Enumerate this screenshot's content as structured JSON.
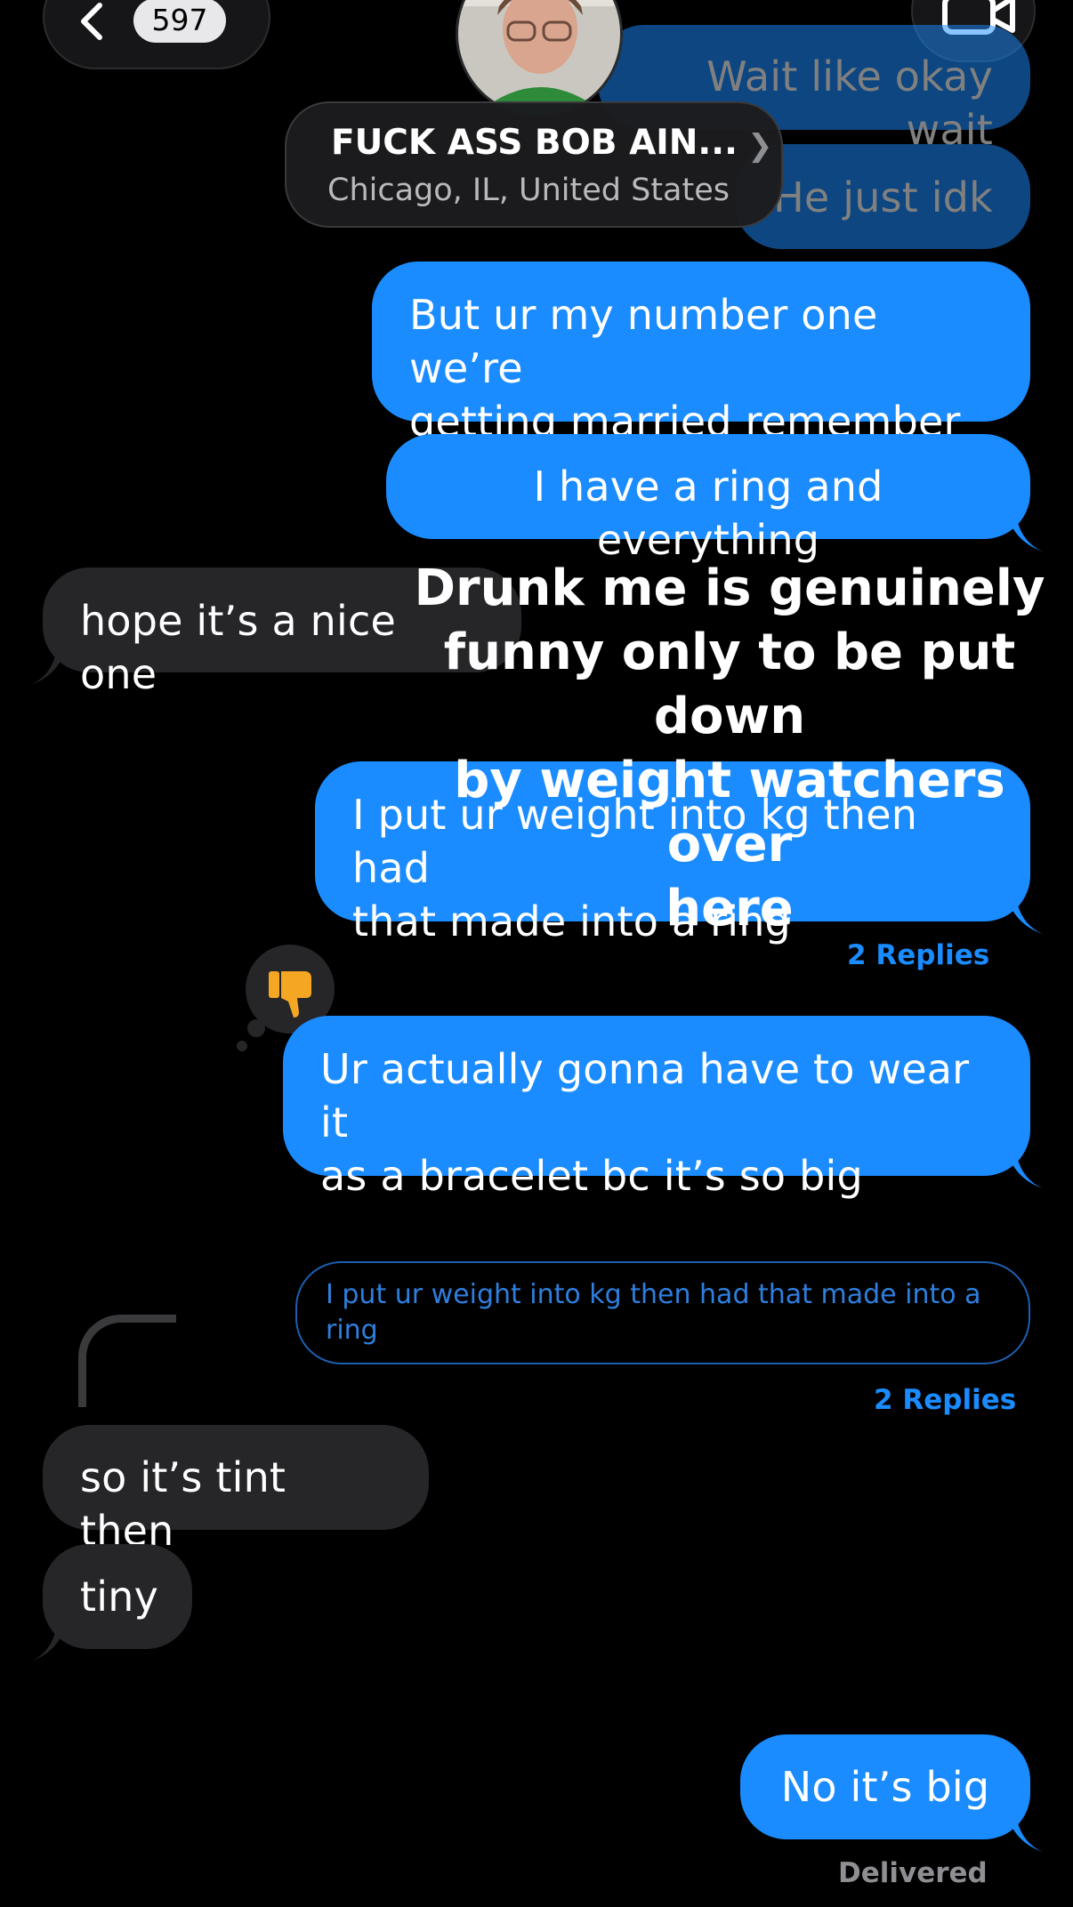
{
  "header": {
    "unread_count": "597",
    "contact_name": "FUCK ASS BOB AIN...",
    "contact_location": "Chicago, IL, United States"
  },
  "messages": {
    "m1": "Wait like okay wait",
    "m2": "He just idk",
    "m3_line1": "But ur my number one we’re",
    "m3_line2": "getting married remember",
    "m4": "I have a ring and everything",
    "m5": "hope it’s a nice one",
    "m6_line1": "I put ur weight into kg then had",
    "m6_line2": "that made into a ring",
    "m6_replies": "2 Replies",
    "m7_line1": "Ur actually gonna have to wear it",
    "m7_line2": "as a bracelet bc it’s so big",
    "quote": "I put ur weight into kg then had that made into a ring",
    "quote_replies": "2 Replies",
    "m8": "so it’s tint then",
    "m9": "tiny",
    "m10": "No it’s big",
    "status": "Delivered"
  },
  "overlay": {
    "line1": "Drunk me is genuinely",
    "line2": "funny only to be put down",
    "line3": "by weight watchers over",
    "line4": "here"
  },
  "reaction": {
    "icon": "thumbs-down-icon",
    "color": "#f5a623"
  },
  "colors": {
    "sent": "#1a8cff",
    "received": "#262629",
    "background": "#000000"
  }
}
